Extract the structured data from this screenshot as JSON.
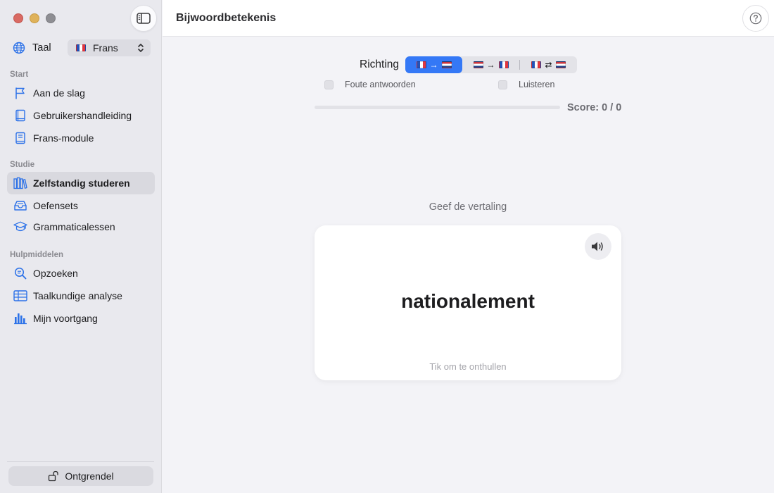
{
  "window": {
    "title": "Bijwoordbetekenis"
  },
  "sidebar": {
    "language_label": "Taal",
    "language_value": "Frans",
    "sections": [
      {
        "title": "Start",
        "items": [
          {
            "label": "Aan de slag",
            "icon": "flag-icon"
          },
          {
            "label": "Gebruikershandleiding",
            "icon": "book-icon"
          },
          {
            "label": "Frans-module",
            "icon": "module-book-icon"
          }
        ]
      },
      {
        "title": "Studie",
        "items": [
          {
            "label": "Zelfstandig studeren",
            "icon": "books-icon",
            "active": true
          },
          {
            "label": "Oefensets",
            "icon": "tray-icon"
          },
          {
            "label": "Grammaticalessen",
            "icon": "graduation-cap-icon"
          }
        ]
      },
      {
        "title": "Hulpmiddelen",
        "items": [
          {
            "label": "Opzoeken",
            "icon": "magnifier-icon"
          },
          {
            "label": "Taalkundige analyse",
            "icon": "table-icon"
          },
          {
            "label": "Mijn voortgang",
            "icon": "bar-chart-icon"
          }
        ]
      }
    ],
    "unlock_label": "Ontgrendel"
  },
  "main": {
    "direction_label": "Richting",
    "direction_options": [
      {
        "id": "fr-nl",
        "symbol": "→",
        "active": true
      },
      {
        "id": "nl-fr",
        "symbol": "→",
        "active": false
      },
      {
        "id": "fr-nl-both",
        "symbol": "⇄",
        "active": false
      }
    ],
    "options": {
      "wrong_answers_label": "Foute antwoorden",
      "wrong_answers_checked": false,
      "listen_label": "Luisteren",
      "listen_checked": false
    },
    "progress": 0,
    "score_label": "Score:",
    "score_value": "0 / 0",
    "prompt": "Geef de vertaling",
    "card": {
      "word": "nationalement",
      "hint": "Tik om te onthullen"
    }
  },
  "colors": {
    "accent": "#3478f6",
    "sidebar_bg": "#e9e9ee",
    "content_bg": "#f3f3f7"
  }
}
